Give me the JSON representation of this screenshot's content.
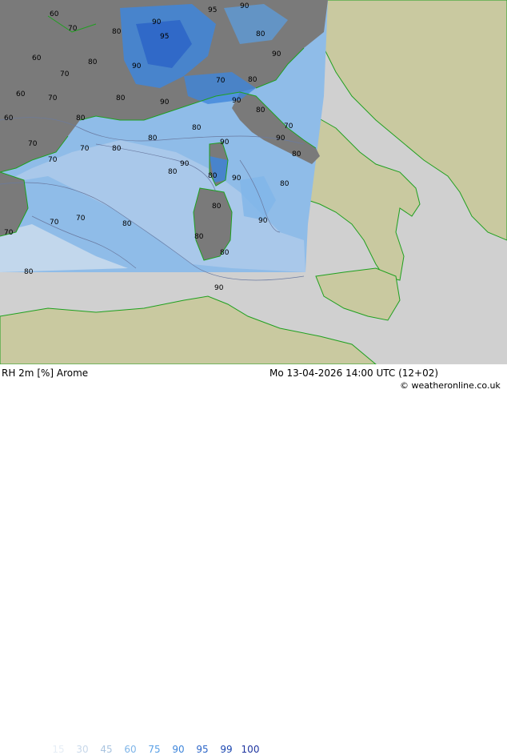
{
  "title": "RH 2m [%] Arome",
  "datetime": "Mo 13-04-2026 14:00 UTC (12+02)",
  "copyright": "© weatheronline.co.uk",
  "legend": [
    {
      "value": "15",
      "color": "#e6eef6"
    },
    {
      "value": "30",
      "color": "#c8d8ea"
    },
    {
      "value": "45",
      "color": "#a9c4e0"
    },
    {
      "value": "60",
      "color": "#7fb5e8"
    },
    {
      "value": "75",
      "color": "#5aa0e6"
    },
    {
      "value": "90",
      "color": "#3f86db"
    },
    {
      "value": "95",
      "color": "#2d66c8"
    },
    {
      "value": "99",
      "color": "#1b46b0"
    },
    {
      "value": "100",
      "color": "#1f35a0"
    }
  ],
  "colors": {
    "land": "#c9c9a0",
    "sea": "#d0d0d0",
    "model_sea": "#8fbce8",
    "model_land": "#7a7a7a",
    "coast": "#1fa01f",
    "contour": "#6a7aa0"
  },
  "contour_labels": [
    "60",
    "70",
    "80",
    "90",
    "95",
    "60",
    "70",
    "80",
    "90",
    "95",
    "60",
    "70",
    "80",
    "90",
    "80",
    "70",
    "90",
    "80",
    "90",
    "80",
    "90",
    "80",
    "90",
    "80",
    "70",
    "80",
    "90",
    "80",
    "70",
    "80",
    "90",
    "80",
    "70",
    "80",
    "90",
    "80",
    "70",
    "80",
    "90",
    "80",
    "70",
    "60",
    "70",
    "80",
    "90",
    "80",
    "70",
    "80"
  ]
}
